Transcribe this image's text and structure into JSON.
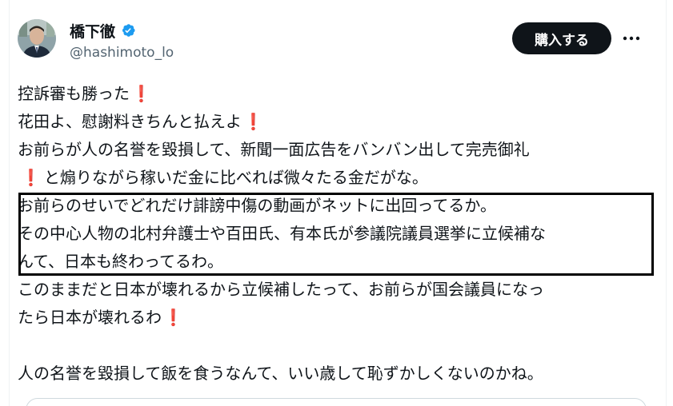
{
  "author": {
    "display_name": "橋下徹",
    "handle": "@hashimoto_lo",
    "verified": true,
    "avatar_icon": "person-portrait-avatar"
  },
  "actions": {
    "buy_label": "購入する",
    "more_icon": "more-horizontal-icon"
  },
  "tweet": {
    "lines": [
      {
        "text": "控訴審も勝った",
        "trailing_emoji": "❗"
      },
      {
        "text": "花田よ、慰謝料きちんと払えよ",
        "trailing_emoji": "❗"
      },
      {
        "text": "お前らが人の名誉を毀損して、新聞一面広告をバンバン出して完売御礼",
        "trailing_emoji": ""
      },
      {
        "leading_emoji": "❗",
        "text": "と煽りながら稼いだ金に比べれば微々たる金だがな。"
      },
      {
        "text": "お前らのせいでどれだけ誹謗中傷の動画がネットに出回ってるか。"
      },
      {
        "text": "その中心人物の北村弁護士や百田氏、有本氏が参議院議員選挙に立候補な"
      },
      {
        "text": "んて、日本も終わってるわ。"
      },
      {
        "text": "このままだと日本が壊れるから立候補したって、お前らが国会議員になっ"
      },
      {
        "text": "たら日本が壊れるわ",
        "trailing_emoji": "❗"
      },
      {
        "text": ""
      },
      {
        "text": "人の名誉を毀損して飯を食うなんて、いい歳して恥ずかしくないのかね。"
      }
    ]
  },
  "colors": {
    "text": "#0f1419",
    "secondary": "#536471",
    "verified_blue": "#1d9bf0",
    "button_bg": "#0f1419",
    "emoji_red": "#dd2e44",
    "highlight_border": "#000000"
  }
}
